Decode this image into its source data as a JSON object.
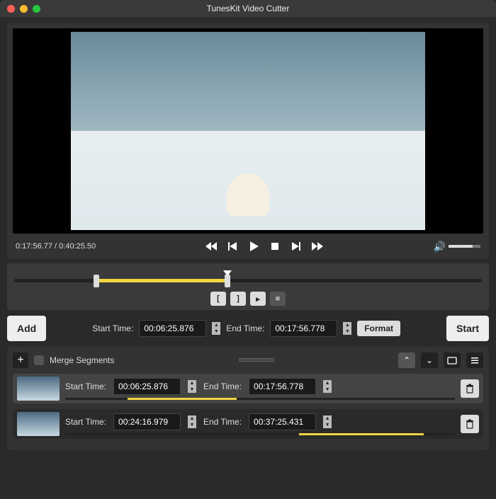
{
  "window": {
    "title": "TunesKit Video Cutter"
  },
  "player": {
    "current_time": "0:17:56.77",
    "total_time": "0:40:25.50"
  },
  "cut": {
    "add_label": "Add",
    "start_label": "Start Time:",
    "start_value": "00:06:25.876",
    "end_label": "End Time:",
    "end_value": "00:17:56.778",
    "format_label": "Format",
    "start_btn": "Start"
  },
  "segments": {
    "merge_label": "Merge Segments",
    "items": [
      {
        "start_label": "Start Time:",
        "start": "00:06:25.876",
        "end_label": "End Time:",
        "end": "00:17:56.778",
        "sel_left": "16%",
        "sel_width": "28%"
      },
      {
        "start_label": "Start Time:",
        "start": "00:24:16.979",
        "end_label": "End Time:",
        "end": "00:37:25.431",
        "sel_left": "60%",
        "sel_width": "32%"
      }
    ]
  }
}
